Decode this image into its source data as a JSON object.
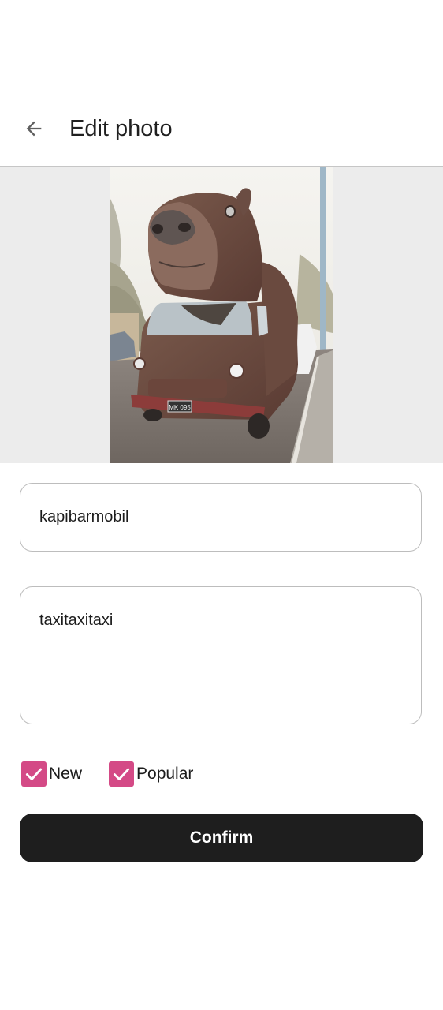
{
  "header": {
    "back_icon": "arrow-back-icon",
    "title": "Edit photo"
  },
  "photo": {
    "description": "Van covered in brown fur with a giant capybara head on its roof, parked on a cobblestone street",
    "plate_text": "MK 095"
  },
  "form": {
    "title_value": "kapibarmobil",
    "description_value": "taxitaxitaxi",
    "checkboxes": [
      {
        "label": "New",
        "checked": true
      },
      {
        "label": "Popular",
        "checked": true
      }
    ],
    "confirm_label": "Confirm"
  },
  "colors": {
    "accent": "#d44a86",
    "button": "#1e1e1e",
    "photo_background": "#ececec",
    "divider": "#c6c6c6"
  }
}
